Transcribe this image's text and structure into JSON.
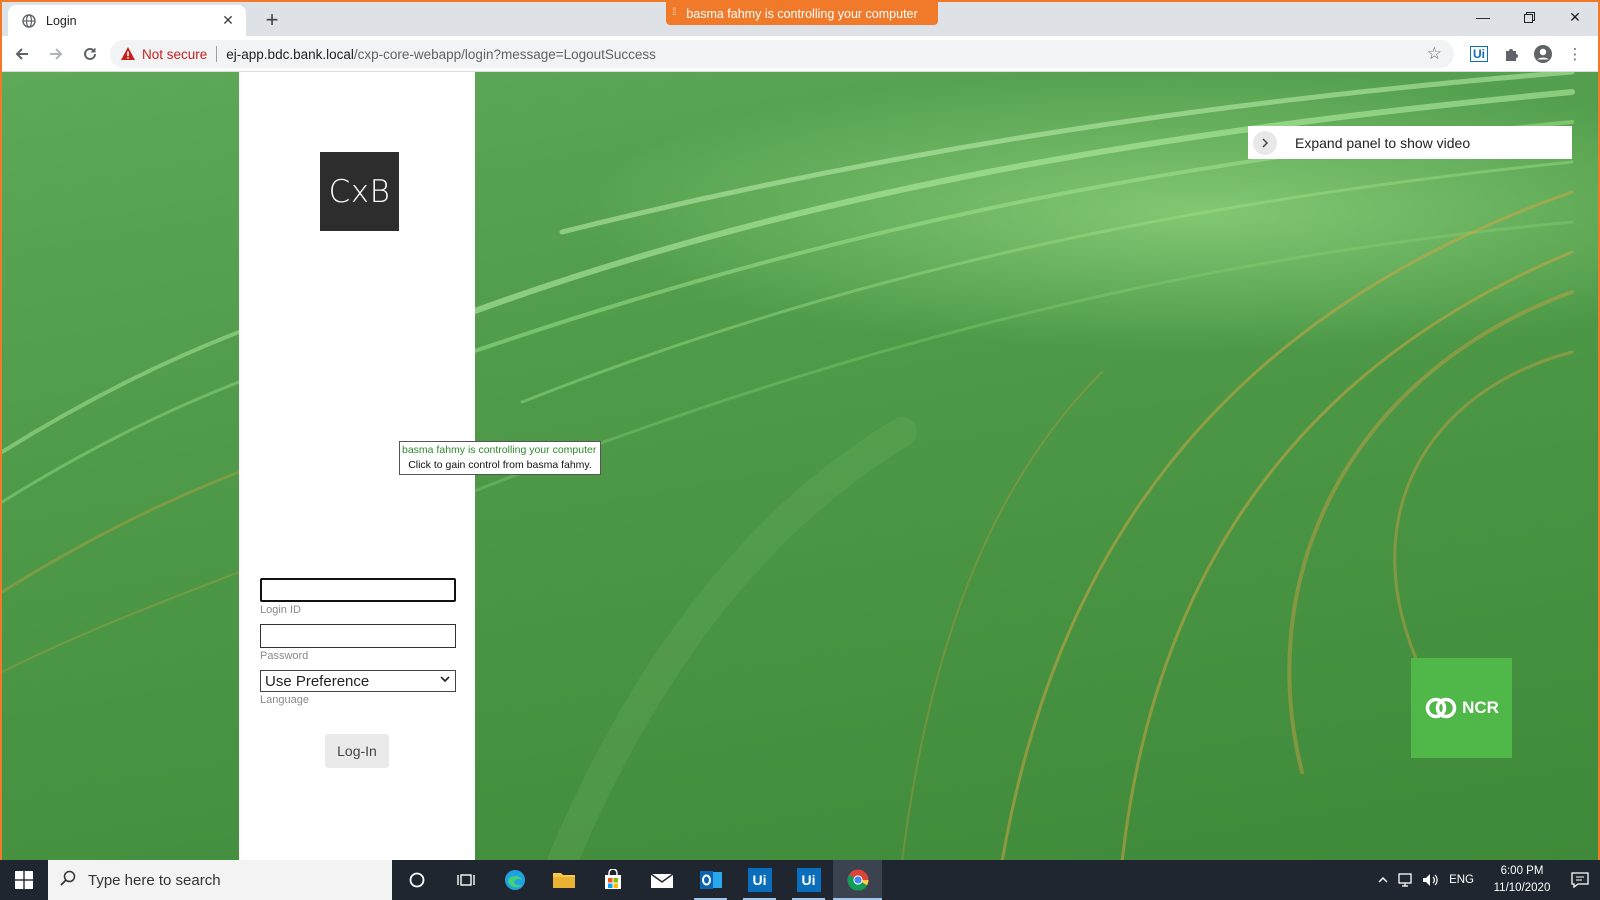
{
  "browser": {
    "tab_title": "Login",
    "control_banner": "basma fahmy is controlling your computer",
    "security_label": "Not secure",
    "url_host": "ej-app.bdc.bank.local",
    "url_path": "/cxp-core-webapp/login?message=LogoutSuccess"
  },
  "login": {
    "logo_text": "CxB",
    "login_id_value": "",
    "login_id_label": "Login ID",
    "password_value": "",
    "password_label": "Password",
    "language_selected": "Use Preference",
    "language_label": "Language",
    "submit_label": "Log-In"
  },
  "tooltip": {
    "line1": "basma fahmy is controlling your computer",
    "line2": "Click to gain control from basma fahmy."
  },
  "video_panel": {
    "label": "Expand panel to show video"
  },
  "brand": {
    "ncr_text": "NCR",
    "ncr_color": "#50b848"
  },
  "taskbar": {
    "search_placeholder": "Type here to search",
    "language": "ENG",
    "time": "6:00 PM",
    "date": "11/10/2020",
    "apps": [
      "cortana-icon",
      "task-view-icon",
      "edge-icon",
      "file-explorer-icon",
      "store-icon",
      "mail-icon",
      "outlook-icon",
      "uipath-icon",
      "uipath-icon",
      "chrome-icon"
    ],
    "uipath_label": "Ui"
  },
  "colors": {
    "remote_accent": "#f07a2a",
    "not_secure": "#c5221f"
  }
}
